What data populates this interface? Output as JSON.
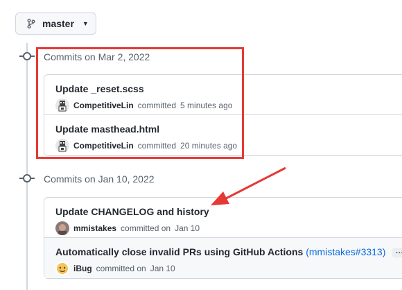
{
  "branch": {
    "icon": "git-branch-icon",
    "label": "master"
  },
  "groups": [
    {
      "title": "Commits on Mar 2, 2022",
      "commits": [
        {
          "message": "Update _reset.scss",
          "author": "CompetitiveLin",
          "verb": "committed",
          "time": "5 minutes ago"
        },
        {
          "message": "Update masthead.html",
          "author": "CompetitiveLin",
          "verb": "committed",
          "time": "20 minutes ago"
        }
      ]
    },
    {
      "title": "Commits on Jan 10, 2022",
      "commits": [
        {
          "message": "Update CHANGELOG and history",
          "author": "mmistakes",
          "verb": "committed on",
          "time": "Jan 10"
        },
        {
          "message": "Automatically close invalid PRs using GitHub Actions",
          "pr_open": "(",
          "pr_link": "mmistakes#3313",
          "pr_close": ")",
          "ellipsis": "…",
          "author": "iBug",
          "verb": "committed on",
          "time": "Jan 10"
        }
      ]
    }
  ],
  "colors": {
    "annotation": "#e53935",
    "link": "#0969da",
    "border": "#d0d7de",
    "muted": "#57606a"
  }
}
